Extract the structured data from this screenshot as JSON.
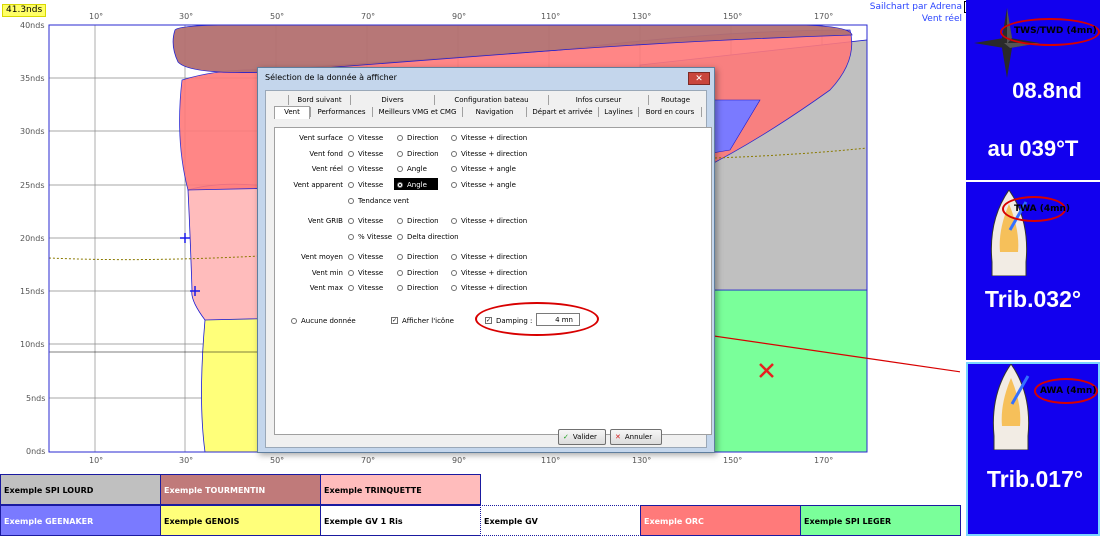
{
  "chart": {
    "corner_label": "41.3nds",
    "y_labels": [
      "40nds",
      "35nds",
      "30nds",
      "25nds",
      "20nds",
      "15nds",
      "10nds",
      "5nds",
      "0nds"
    ],
    "x_labels": [
      "10°",
      "30°",
      "50°",
      "70°",
      "90°",
      "110°",
      "130°",
      "150°",
      "170°"
    ],
    "brand_line1": "Sailchart par Adrena",
    "brand_line2": "Vent réel",
    "colors": {
      "grid": "#8a8a8a",
      "border": "#2a2ad0",
      "marker": "#e82020",
      "cross": "#1a1ae8"
    }
  },
  "legend": {
    "row1": [
      "Exemple SPI LOURD",
      "Exemple TOURMENTIN",
      "Exemple TRINQUETTE"
    ],
    "row2": [
      "Exemple GEENAKER",
      "Exemple GENOIS",
      "Exemple GV 1 Ris",
      "Exemple GV",
      "Exemple ORC",
      "Exemple SPI LEGER"
    ],
    "colors_row1": [
      "#c0c0c0",
      "#c07a7a",
      "#ffbcbc"
    ],
    "colors_row2": [
      "#7a7aff",
      "#ffff7a",
      "#ffffff",
      "#ffffff",
      "#ff7a7a",
      "#7aff9a"
    ]
  },
  "panels": [
    {
      "tag": "TWS/TWD (4mn)",
      "line1": "08.8nd",
      "line2": "au 039°T",
      "icon": "compass-rose-icon"
    },
    {
      "tag": "TWA (4mn)",
      "value": "Trib.032°",
      "icon": "boat-icon"
    },
    {
      "tag": "AWA (4mn)",
      "value": "Trib.017°",
      "icon": "boat-icon"
    }
  ],
  "close_mark": "✕",
  "dialog": {
    "title": "Sélection de la donnée à afficher",
    "close": "✕",
    "tabs_row1": [
      "Bord suivant",
      "Divers",
      "Configuration bateau",
      "Infos curseur",
      "Routage"
    ],
    "tabs_row2": [
      "Vent",
      "Performances",
      "Meilleurs VMG et CMG",
      "Navigation",
      "Départ et arrivée",
      "Laylines",
      "Bord en cours"
    ],
    "rows": [
      {
        "label": "Vent surface",
        "options": [
          "Vitesse",
          "Direction",
          "Vitesse + direction"
        ]
      },
      {
        "label": "Vent fond",
        "options": [
          "Vitesse",
          "Direction",
          "Vitesse + direction"
        ]
      },
      {
        "label": "Vent réel",
        "options": [
          "Vitesse",
          "Angle",
          "Vitesse + angle"
        ]
      },
      {
        "label": "Vent apparent",
        "options": [
          "Vitesse",
          "Angle",
          "Vitesse + angle"
        ]
      },
      {
        "label": "",
        "options": [
          "Tendance vent"
        ]
      },
      {
        "label": "Vent GRIB",
        "options": [
          "Vitesse",
          "Direction",
          "Vitesse + direction"
        ]
      },
      {
        "label": "",
        "options": [
          "% Vitesse",
          "Delta direction"
        ]
      },
      {
        "label": "Vent moyen",
        "options": [
          "Vitesse",
          "Direction",
          "Vitesse + direction"
        ]
      },
      {
        "label": "Vent min",
        "options": [
          "Vitesse",
          "Direction",
          "Vitesse + direction"
        ]
      },
      {
        "label": "Vent max",
        "options": [
          "Vitesse",
          "Direction",
          "Vitesse + direction"
        ]
      }
    ],
    "no_data": "Aucune donnée",
    "show_icon": "Afficher l'icône",
    "damping_label": "Damping :",
    "damping_value": "4 mn",
    "validate": "Valider",
    "cancel": "Annuler"
  }
}
